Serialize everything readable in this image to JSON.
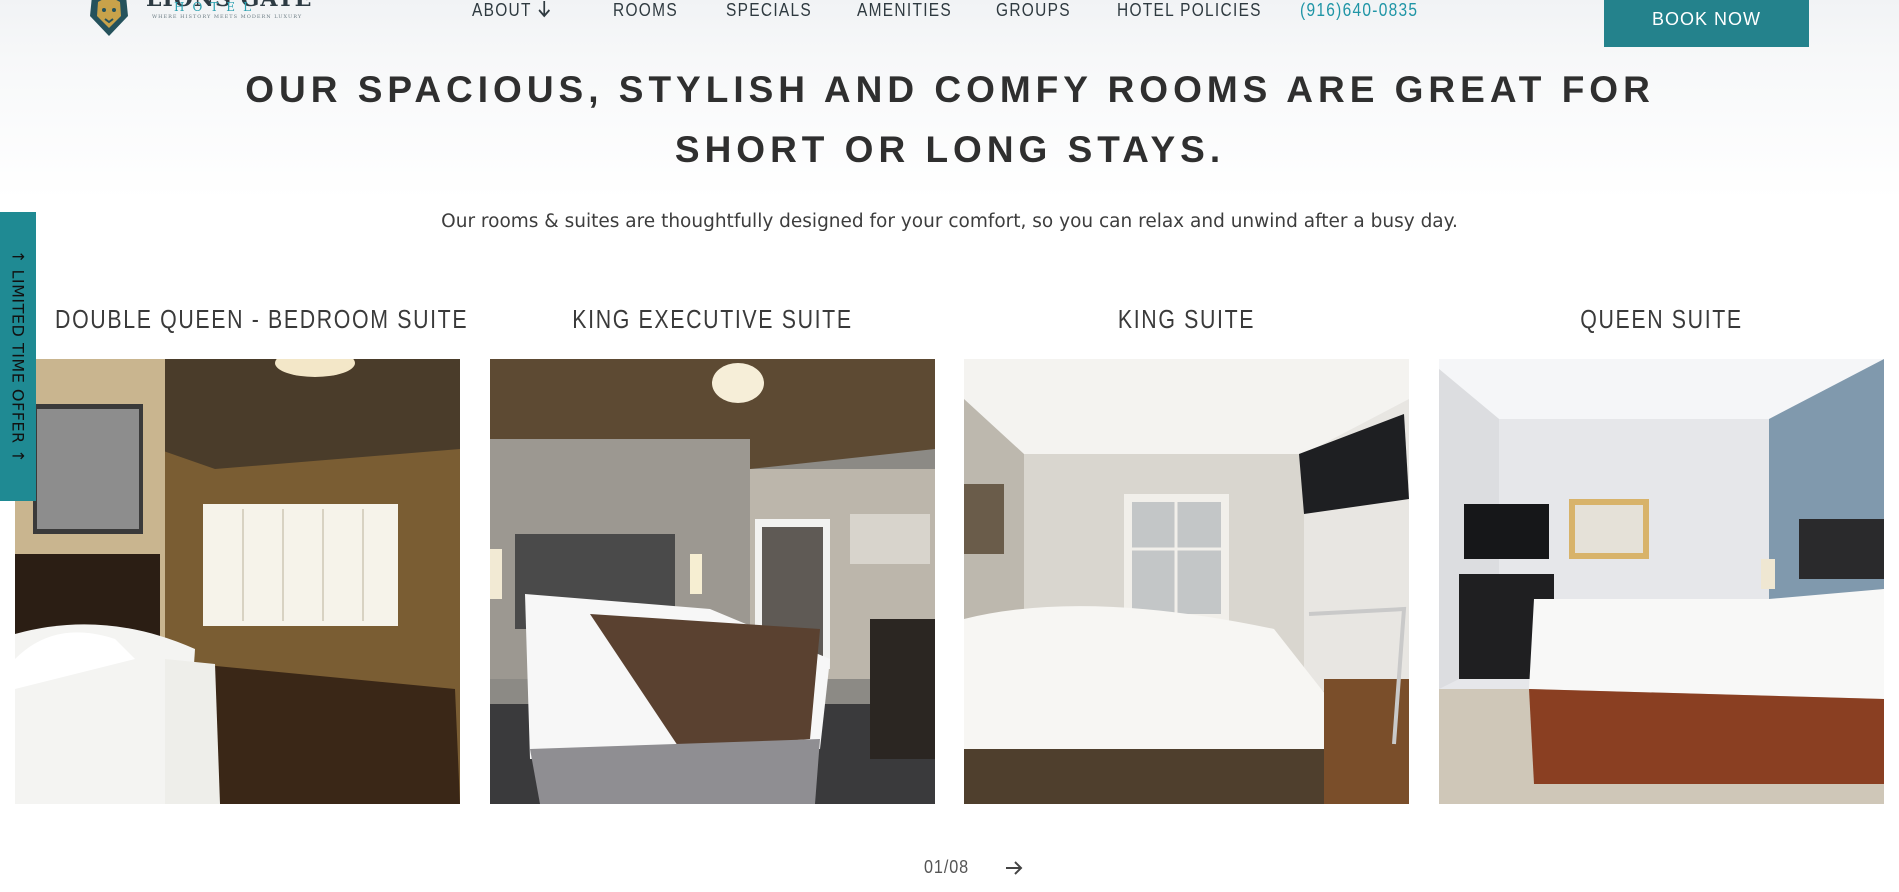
{
  "brand": {
    "name": "LIONS GATE",
    "sub": "HOTEL",
    "tagline": "WHERE HISTORY MEETS MODERN LUXURY",
    "colors": {
      "teal": "#24828c",
      "phone": "#1f95a6",
      "side_tab": "#1f8a93"
    }
  },
  "nav": {
    "items": [
      {
        "label": "ABOUT",
        "icon": "arrow-down-icon"
      },
      {
        "label": "ROOMS"
      },
      {
        "label": "SPECIALS"
      },
      {
        "label": "AMENITIES"
      },
      {
        "label": "GROUPS"
      },
      {
        "label": "HOTEL POLICIES"
      }
    ],
    "phone": "(916)640-0835",
    "book_label": "BOOK NOW"
  },
  "hero": {
    "headline_line1": "OUR SPACIOUS, STYLISH AND COMFY ROOMS ARE GREAT FOR",
    "headline_line2": "SHORT OR LONG STAYS.",
    "subtext": "Our rooms & suites are thoughtfully designed for your comfort, so you can relax and unwind after a busy day."
  },
  "side_tab": {
    "label": "↑ LIMITED TIME OFFER ↑"
  },
  "rooms": [
    {
      "title": "DOUBLE QUEEN - BEDROOM SUITE"
    },
    {
      "title": "KING EXECUTIVE SUITE"
    },
    {
      "title": "KING SUITE"
    },
    {
      "title": "QUEEN SUITE"
    }
  ],
  "pager": {
    "count": "01/08",
    "next_icon": "arrow-right-icon"
  }
}
